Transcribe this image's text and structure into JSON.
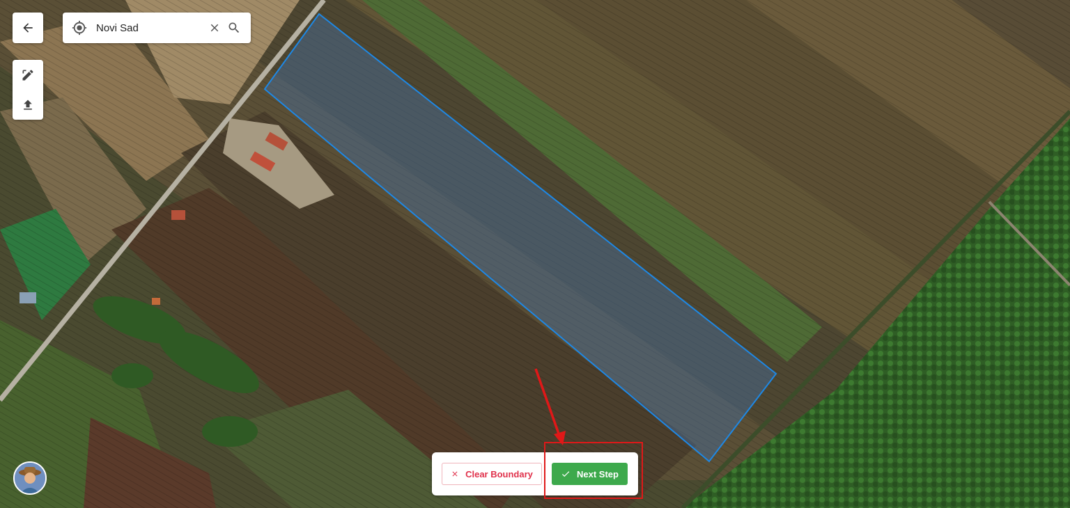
{
  "search": {
    "value": "Novi Sad",
    "location_icon": "crosshair-icon",
    "clear_icon": "close-icon",
    "search_icon": "search-icon"
  },
  "nav": {
    "back_icon": "arrow-left-icon"
  },
  "tools": [
    {
      "icon": "draw-polygon-icon"
    },
    {
      "icon": "upload-icon"
    }
  ],
  "actions": {
    "clear_label": "Clear Boundary",
    "next_label": "Next Step"
  },
  "colors": {
    "boundary": "#1e88e5",
    "clear_accent": "#e0314b",
    "next_bg": "#3da94c",
    "highlight": "#e01818"
  }
}
